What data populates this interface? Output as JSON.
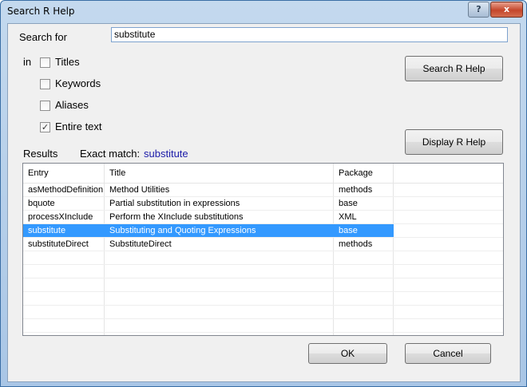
{
  "window": {
    "title": "Search R Help",
    "help_glyph": "?",
    "close_glyph": "x"
  },
  "search": {
    "label": "Search for",
    "value": "substitute"
  },
  "scope": {
    "label": "in",
    "options": [
      {
        "label": "Titles",
        "checked": false
      },
      {
        "label": "Keywords",
        "checked": false
      },
      {
        "label": "Aliases",
        "checked": false
      },
      {
        "label": "Entire text",
        "checked": true
      }
    ]
  },
  "buttons": {
    "search": "Search R Help",
    "display": "Display R Help",
    "ok": "OK",
    "cancel": "Cancel"
  },
  "results": {
    "label": "Results",
    "exact_label": "Exact match:",
    "exact_value": "substitute",
    "exact_color": "#1a1aa8"
  },
  "table": {
    "columns": [
      "Entry",
      "Title",
      "Package"
    ],
    "rows": [
      [
        "asMethodDefinition",
        "Method Utilities",
        "methods"
      ],
      [
        "bquote",
        "Partial substitution in expressions",
        "base"
      ],
      [
        "processXInclude",
        "Perform the XInclude substitutions",
        "XML"
      ],
      [
        "substitute",
        "Substituting and Quoting Expressions",
        "base"
      ],
      [
        "substituteDirect",
        "SubstituteDirect",
        "methods"
      ]
    ],
    "selected_index": 3,
    "selection_color": "#3399ff"
  }
}
